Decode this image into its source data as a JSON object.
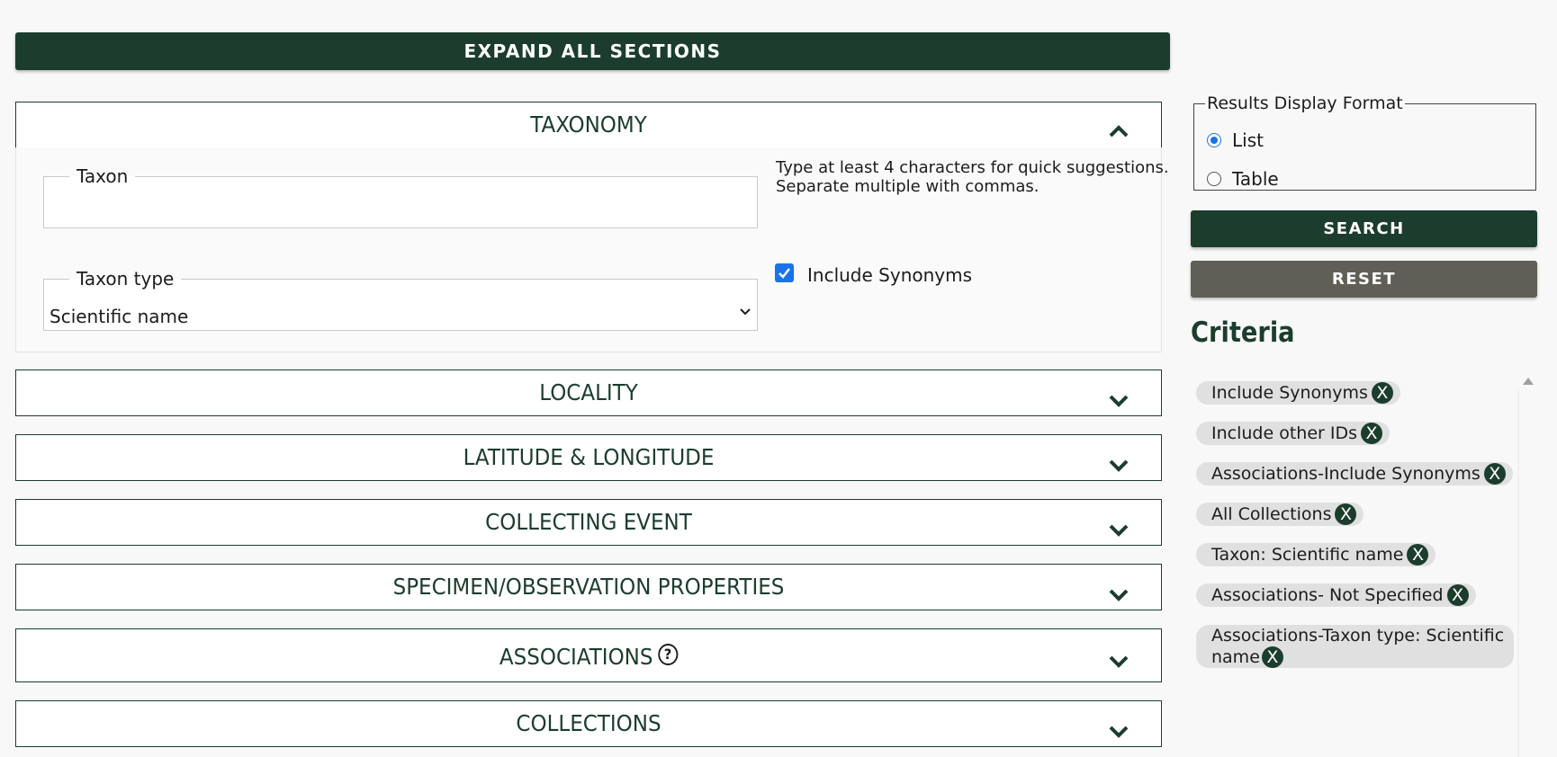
{
  "toolbar": {
    "expand_all_label": "EXPAND ALL SECTIONS"
  },
  "sections": {
    "taxonomy": "TAXONOMY",
    "locality": "LOCALITY",
    "latlong": "LATITUDE & LONGITUDE",
    "collecting_event": "COLLECTING EVENT",
    "specimen_props": "SPECIMEN/OBSERVATION PROPERTIES",
    "associations": "ASSOCIATIONS",
    "collections": "COLLECTIONS"
  },
  "taxonomy": {
    "taxon_label": "Taxon",
    "taxon_value": "",
    "taxon_help_1": "Type at least 4 characters for quick suggestions.",
    "taxon_help_2": "Separate multiple with commas.",
    "taxon_type_label": "Taxon type",
    "taxon_type_value": "Scientific name",
    "include_synonyms_label": "Include Synonyms",
    "include_synonyms_checked": true
  },
  "display_format": {
    "legend": "Results Display Format",
    "options": [
      "List",
      "Table"
    ],
    "selected": "List"
  },
  "actions": {
    "search": "SEARCH",
    "reset": "RESET"
  },
  "criteria": {
    "title": "Criteria",
    "remove_glyph": "X",
    "chips": [
      "Include Synonyms",
      "Include other IDs",
      "Associations-Include Synonyms",
      "All Collections",
      "Taxon: Scientific name",
      "Associations- Not Specified",
      "Associations-Taxon type: Scientific name"
    ]
  },
  "icons": {
    "help": "?",
    "chevron_up": "chevron-up-icon",
    "chevron_down": "chevron-down-icon"
  },
  "colors": {
    "brand_green": "#1c3d2e",
    "reset_gray": "#5f5f57",
    "accent_blue": "#1a73e8",
    "chip_bg": "#e0e0e0"
  }
}
